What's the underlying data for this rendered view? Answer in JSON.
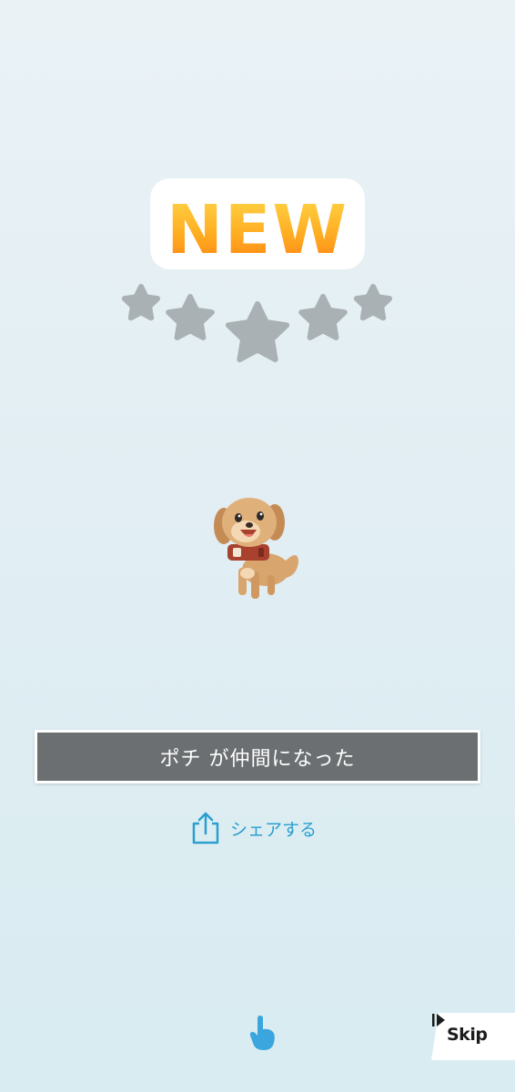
{
  "badge": {
    "text": "NEW"
  },
  "rarity": {
    "stars_total": 5,
    "stars_filled": 0
  },
  "character": {
    "icon": "dog-character-icon"
  },
  "message": {
    "text": "ポチ が仲間になった"
  },
  "share": {
    "label": "シェアする",
    "icon": "share-icon"
  },
  "tap_hint": {
    "icon": "pointing-hand-icon"
  },
  "skip": {
    "label": "Skip",
    "icon": "skip-arrow-icon"
  },
  "colors": {
    "accent": "#2a9fd0",
    "badge_orange": "#ff9a1a",
    "star_gray": "#a9b1b4",
    "bar_gray": "#6b6f71"
  }
}
